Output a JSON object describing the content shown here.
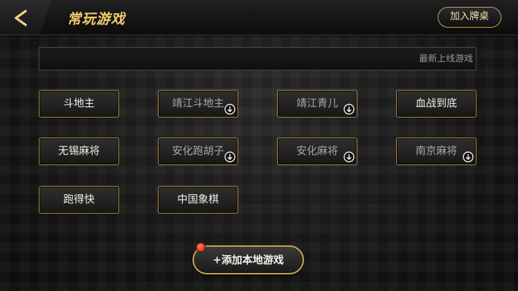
{
  "header": {
    "title": "常玩游戏",
    "join_table_label": "加入牌桌"
  },
  "search": {
    "placeholder": "最新上线游戏"
  },
  "games": [
    {
      "label": "斗地主",
      "downloadable": false
    },
    {
      "label": "靖江斗地主",
      "downloadable": true
    },
    {
      "label": "靖江青儿",
      "downloadable": true
    },
    {
      "label": "血战到底",
      "downloadable": false
    },
    {
      "label": "无锡麻将",
      "downloadable": false
    },
    {
      "label": "安化跑胡子",
      "downloadable": true
    },
    {
      "label": "安化麻将",
      "downloadable": true
    },
    {
      "label": "南京麻将",
      "downloadable": true
    },
    {
      "label": "跑得快",
      "downloadable": false
    },
    {
      "label": "中国象棋",
      "downloadable": false
    }
  ],
  "add_game_label": "添加本地游戏",
  "icons": {
    "back": "back-chevron-icon",
    "download": "download-circle-icon",
    "add": "plus-icon",
    "notification": "red-dot-badge"
  },
  "colors": {
    "accent_gold": "#c9a55a",
    "title_gold": "#e9c873",
    "badge_red": "#d8301a"
  }
}
